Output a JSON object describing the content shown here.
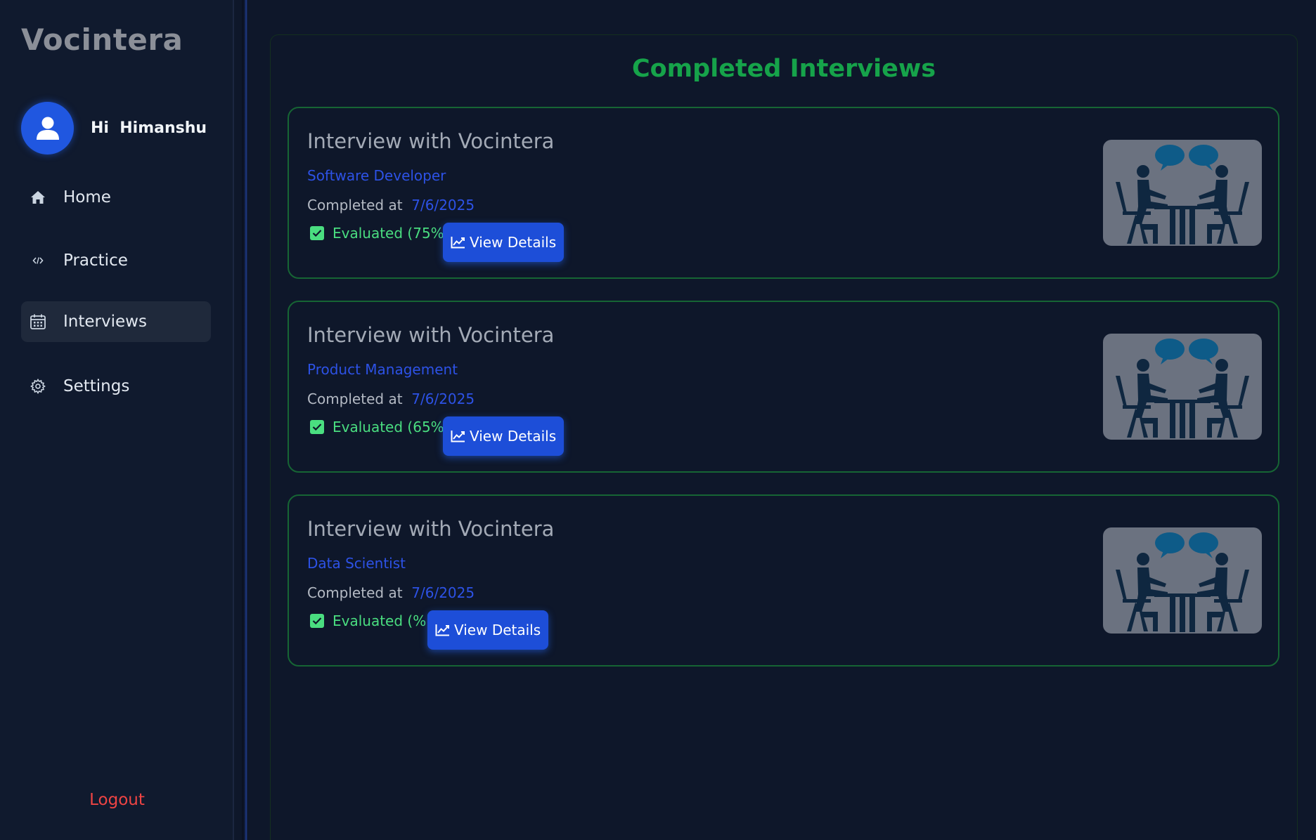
{
  "sidebar": {
    "brand": "Vocintera",
    "greeting": "Hi  Himanshu",
    "items": [
      {
        "label": "Home",
        "icon": "home-icon"
      },
      {
        "label": "Practice",
        "icon": "code-icon"
      },
      {
        "label": "Interviews",
        "icon": "calendar-icon",
        "active": true
      },
      {
        "label": "Settings",
        "icon": "gear-icon"
      }
    ],
    "logout": "Logout"
  },
  "main": {
    "title": "Completed Interviews",
    "cards": [
      {
        "title": "Interview with Vocintera",
        "role": "Software Developer",
        "completed_label": "Completed at  ",
        "date": "7/6/2025",
        "evaluation": "Evaluated (75%)",
        "button": "View Details"
      },
      {
        "title": "Interview with Vocintera",
        "role": "Product Management",
        "completed_label": "Completed at  ",
        "date": "7/6/2025",
        "evaluation": "Evaluated (65%)",
        "button": "View Details"
      },
      {
        "title": "Interview with Vocintera",
        "role": "Data Scientist",
        "completed_label": "Completed at  ",
        "date": "7/6/2025",
        "evaluation": "Evaluated (%)",
        "button": "View Details"
      }
    ]
  },
  "colors": {
    "background": "#0e172a",
    "sidebar": "#101a2e",
    "accent_blue": "#1d4ed8",
    "accent_green": "#16a34a",
    "evaluated_green": "#4ade80",
    "logout_red": "#ef4444"
  }
}
